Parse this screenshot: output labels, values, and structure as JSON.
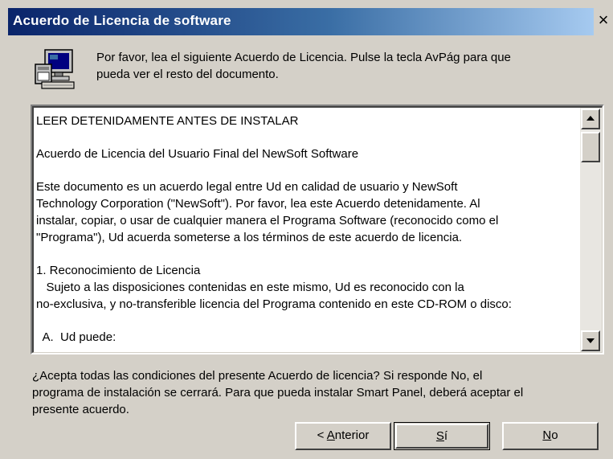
{
  "window": {
    "title": "Acuerdo de Licencia de software",
    "close_glyph": "×"
  },
  "header": {
    "icon": "computer-setup-icon",
    "intro_line1": "Por favor, lea el siguiente Acuerdo de Licencia. Pulse la tecla AvPág para que",
    "intro_line2": "pueda ver el resto del documento."
  },
  "license": {
    "lines": [
      "LEER DETENIDAMENTE ANTES DE INSTALAR",
      "Acuerdo de Licencia del Usuario Final del NewSoft Software",
      "Este documento es un acuerdo legal entre Ud en calidad de usuario y NewSoft",
      "Technology Corporation (\"NewSoft\"). Por favor, lea este Acuerdo detenidamente. Al",
      "instalar, copiar, o usar de cualquier manera el Programa Software (reconocido como el",
      "\"Programa\"), Ud acuerda someterse a los términos de este acuerdo de licencia.",
      "1. Reconocimiento de Licencia",
      "   Sujeto a las disposiciones contenidas en este mismo, Ud es reconocido con la",
      "no-exclusiva, y no-transferible licencia del Programa contenido en este CD-ROM o disco:",
      "  A.  Ud puede:"
    ]
  },
  "question": {
    "line1": "¿Acepta todas las condiciones del presente Acuerdo de licencia? Si responde No, el",
    "line2": "programa de instalación se cerrará. Para que pueda instalar Smart Panel, deberá aceptar el",
    "line3": "presente acuerdo."
  },
  "buttons": {
    "back_prefix": "< ",
    "back_mnemonic": "A",
    "back_rest": "nterior",
    "yes_mnemonic": "S",
    "yes_rest": "í",
    "no_mnemonic": "N",
    "no_rest": "o"
  }
}
